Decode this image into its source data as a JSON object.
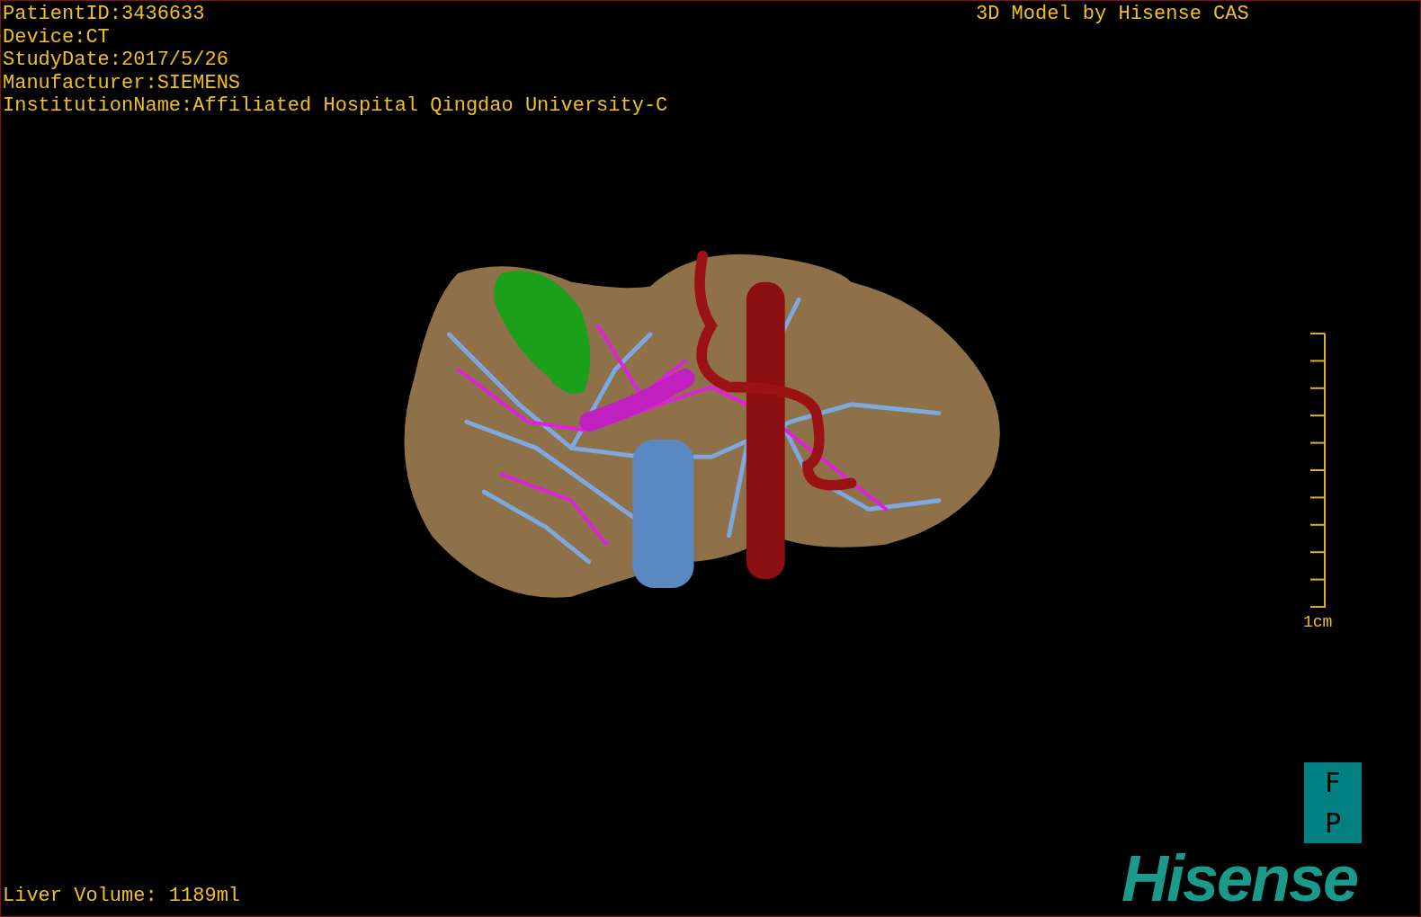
{
  "patient_info": [
    "PatientID:3436633",
    "Device:CT",
    "StudyDate:2017/5/26",
    "Manufacturer:SIEMENS",
    "InstitutionName:Affiliated Hospital Qingdao University-C"
  ],
  "model_credit": "3D Model by Hisense CAS",
  "scale_label": "1cm",
  "orientation": {
    "top": "F",
    "bottom": "P"
  },
  "logo": "Hisense",
  "liver_volume": "Liver Volume: 1189ml"
}
